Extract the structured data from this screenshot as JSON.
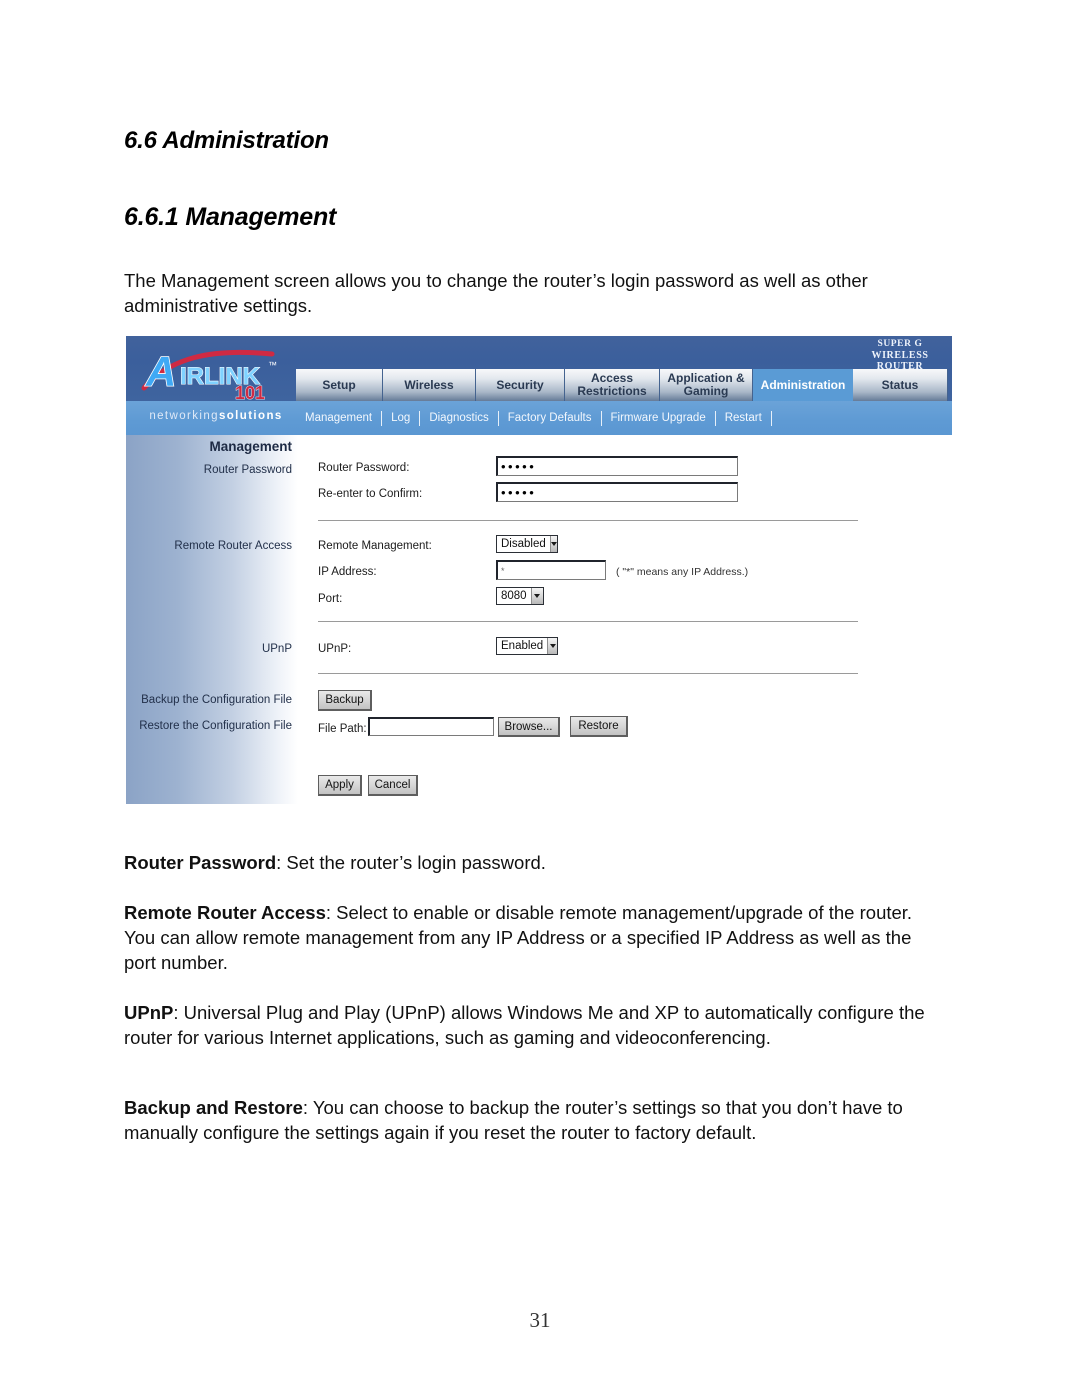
{
  "document": {
    "heading_section": "6.6 Administration",
    "heading_subsection": "6.6.1 Management",
    "intro_paragraph": "The Management screen allows you to change the router’s login password as well as other administrative settings.",
    "page_number": "31",
    "descriptions": [
      {
        "term": "Router Password",
        "text": ": Set the router’s login password."
      },
      {
        "term": "Remote Router Access",
        "text": ": Select to enable or disable remote management/upgrade of the router. You can allow remote management from any IP Address or a specified IP Address as well as the port number."
      },
      {
        "term": "UPnP",
        "text": ": Universal Plug and Play (UPnP) allows Windows Me and XP to automatically configure the router for various Internet applications, such as gaming and videoconferencing."
      },
      {
        "term": "Backup and Restore",
        "text": ": You can choose to backup the router’s settings so that you don’t have to manually configure the settings again if you reset the router to factory default."
      }
    ]
  },
  "router_ui": {
    "brand": {
      "logo_letter": "A",
      "logo_name": "IRLINK",
      "logo_number": "101",
      "logo_tm": "™",
      "tagline_light": "networking",
      "tagline_bold": "solutions"
    },
    "badge": {
      "line1": "SUPER G",
      "line2": "WIRELESS ROUTER"
    },
    "tabs": [
      {
        "label": "Setup",
        "active": false
      },
      {
        "label": "Wireless",
        "active": false
      },
      {
        "label": "Security",
        "active": false
      },
      {
        "label": "Access Restrictions",
        "active": false
      },
      {
        "label": "Application & Gaming",
        "active": false
      },
      {
        "label": "Administration",
        "active": true
      },
      {
        "label": "Status",
        "active": false
      }
    ],
    "subtabs": [
      "Management",
      "Log",
      "Diagnostics",
      "Factory Defaults",
      "Firmware Upgrade",
      "Restart"
    ],
    "side_labels": {
      "title": "Management",
      "router_password": "Router Password",
      "remote_router_access": "Remote Router Access",
      "upnp": "UPnP",
      "backup_config": "Backup the Configuration File",
      "restore_config": "Restore the Configuration File"
    },
    "fields": {
      "router_password_label": "Router Password:",
      "router_password_value": "•••••",
      "confirm_label": "Re-enter to Confirm:",
      "confirm_value": "•••••",
      "remote_management_label": "Remote Management:",
      "remote_management_value": "Disabled",
      "ip_address_label": "IP Address:",
      "ip_address_value": "*",
      "ip_address_hint": "( \"*\" means any IP Address.)",
      "port_label": "Port:",
      "port_value": "8080",
      "upnp_label": "UPnP:",
      "upnp_value": "Enabled",
      "file_path_label": "File Path:",
      "file_path_value": ""
    },
    "buttons": {
      "backup": "Backup",
      "browse": "Browse...",
      "restore": "Restore",
      "apply": "Apply",
      "cancel": "Cancel"
    },
    "colors": {
      "header_dark_blue": "#3b5f9c",
      "header_light_blue": "#5e9ad4",
      "active_tab_blue": "#5a9bd5",
      "logo_red": "#cf2a43",
      "sidebar_blue": "#9db2d0"
    }
  }
}
